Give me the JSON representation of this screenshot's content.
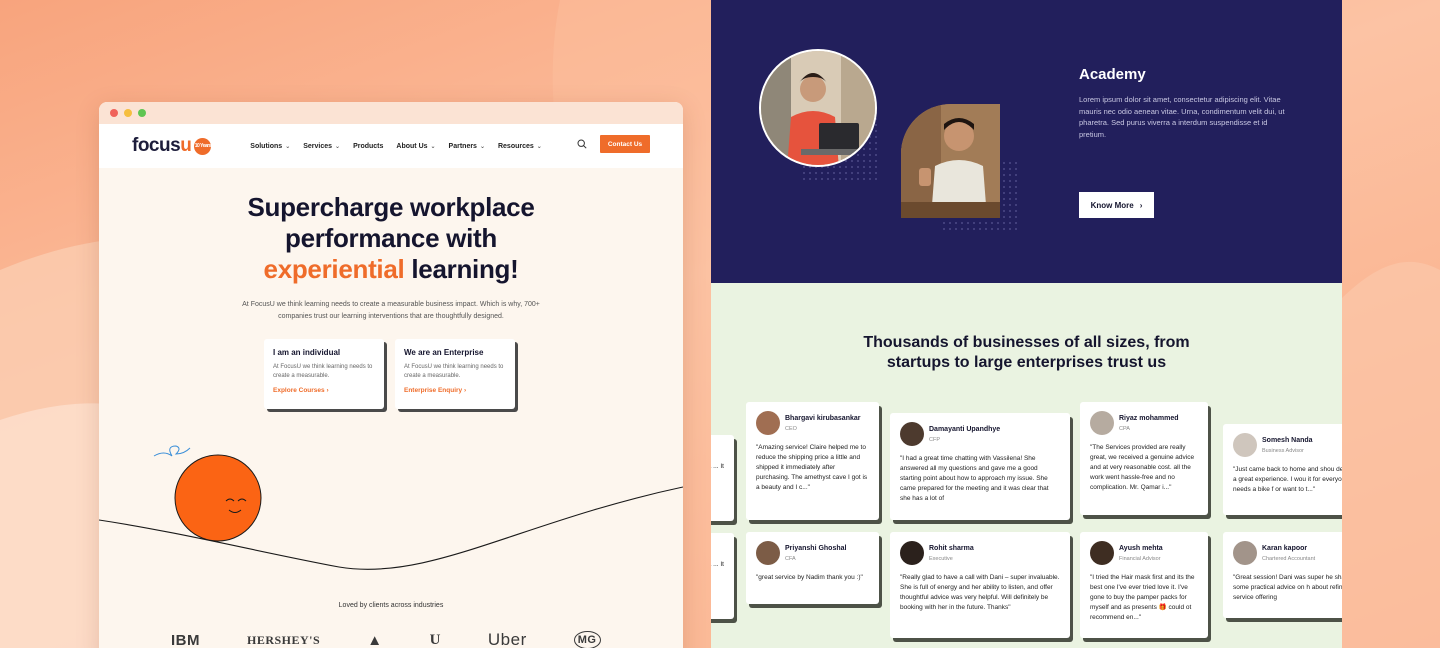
{
  "nav": {
    "logo_focus": "focus",
    "logo_u": "u",
    "logo_badge": "10 Years",
    "items": [
      {
        "label": "Solutions",
        "caret": true
      },
      {
        "label": "Services",
        "caret": true
      },
      {
        "label": "Products",
        "caret": false
      },
      {
        "label": "About Us",
        "caret": true
      },
      {
        "label": "Partners",
        "caret": true
      },
      {
        "label": "Resources",
        "caret": true
      }
    ],
    "contact": "Contact Us"
  },
  "hero": {
    "line1": "Supercharge workplace",
    "line2": "performance with",
    "accent": "experiential",
    "line3_rest": " learning!",
    "subtitle": "At FocusU we think learning needs to create a measurable business impact. Which is why, 700+ companies trust our learning interventions that are thoughtfully designed."
  },
  "choices": [
    {
      "title": "I am an individual",
      "desc": "At FocusU we think learning needs to create a measurable.",
      "link": "Explore Courses"
    },
    {
      "title": "We are an Enterprise",
      "desc": "At FocusU we think learning needs to create a measurable.",
      "link": "Enterprise Enquiry"
    }
  ],
  "clients": {
    "heading": "Loved by clients across industries",
    "brands": [
      "IBM",
      "HERSHEY'S",
      "▲",
      "U",
      "Uber",
      "MG"
    ]
  },
  "academy": {
    "title": "Academy",
    "text": "Lorem ipsum dolor sit amet, consectetur adipiscing elit. Vitae mauris nec odio aenean vitae. Urna, condimentum velit dui, ut pharetra. Sed purus viverra a interdum suspendisse et id pretium.",
    "button": "Know More"
  },
  "trust": {
    "title_line1": "Thousands of businesses of all sizes, from",
    "title_line2": "startups to large enterprises trust us"
  },
  "reviews": [
    {
      "name": "",
      "role": "",
      "text": "...mpla ... It"
    },
    {
      "name": "",
      "role": "",
      "text": "...mpla ... It"
    },
    {
      "name": "Bhargavi kirubasankar",
      "role": "CEO",
      "text": "\"Amazing service! Claire helped me to reduce the shipping price a little and shipped it immediately after purchasing. The amethyst cave I got is a beauty and I c...\""
    },
    {
      "name": "Priyanshi Ghoshal",
      "role": "CFA",
      "text": "\"great service by Nadim thank you :)\""
    },
    {
      "name": "Damayanti Upandhye",
      "role": "CFP",
      "text": "\"I had a great time chatting with Vassilena! She answered all my questions and gave me a good starting point about how to approach my issue. She came prepared for the meeting and it was clear that she has a lot of"
    },
    {
      "name": "Rohit sharma",
      "role": "Executive",
      "text": "\"Really glad to have a call with Dani – super invaluable. She is full of energy and her ability to listen, and offer thoughtful advice was very helpful. Will definitely be booking with her in the future. Thanks\""
    },
    {
      "name": "Riyaz mohammed",
      "role": "CPA",
      "text": "\"The Services provided are really great, we received a genuine advice and at very reasonable cost. all the work went hassle-free and no complication. Mr. Qamar i...\""
    },
    {
      "name": "Ayush mehta",
      "role": "Financial Advisor",
      "text": "\"I tried the Hair mask first and its the best one I've ever tried love it. I've gone to buy the pamper packs for myself and as presents 🎁 could ot recommend en...\""
    },
    {
      "name": "Somesh Nanda",
      "role": "Business Advisor",
      "text": "\"Just came back to home and shou definitely a great experience. I wou it for everyone who needs a bike f or want to t...\""
    },
    {
      "name": "Karan kapoor",
      "role": "Chartered Accountant",
      "text": "\"Great session! Dani was super he shared some practical advice on h about refining our service offering"
    }
  ]
}
